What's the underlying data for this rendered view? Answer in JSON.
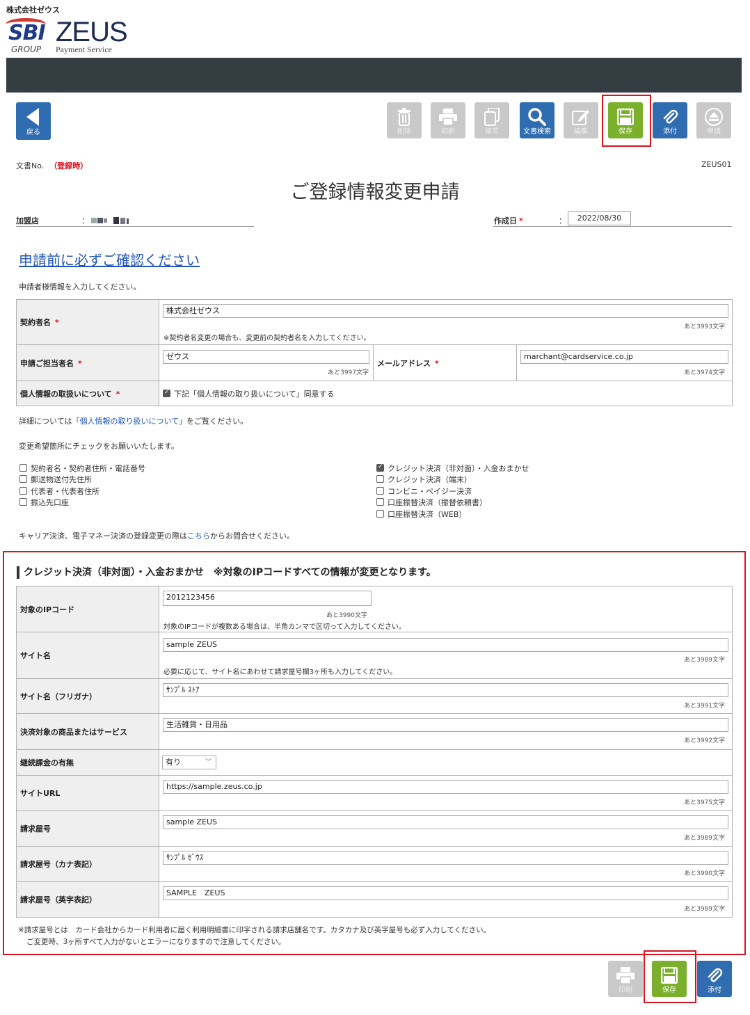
{
  "header": {
    "company": "株式会社ゼウス",
    "logo_sbi": "SBI",
    "logo_group": "GROUP",
    "logo_zeus": "ZEUS",
    "logo_payment": "Payment Service"
  },
  "toolbar": {
    "back": "戻る",
    "buttons": [
      {
        "label": "削除",
        "icon": "trash-icon",
        "state": "disabled"
      },
      {
        "label": "印刷",
        "icon": "print-icon",
        "state": "disabled"
      },
      {
        "label": "複写",
        "icon": "copy-icon",
        "state": "disabled"
      },
      {
        "label": "文書検索",
        "icon": "search-icon",
        "state": "enabled"
      },
      {
        "label": "編集",
        "icon": "edit-icon",
        "state": "disabled"
      },
      {
        "label": "保存",
        "icon": "save-icon",
        "state": "highlighted"
      },
      {
        "label": "添付",
        "icon": "paperclip-icon",
        "state": "enabled"
      },
      {
        "label": "申請",
        "icon": "eject-icon",
        "state": "disabled"
      }
    ]
  },
  "doc": {
    "no_label": "文書No.",
    "no_value": "（登録時）",
    "code": "ZEUS01",
    "title": "ご登録情報変更申請",
    "merchant_label": "加盟店",
    "colon": "：",
    "created_label": "作成日",
    "required_mark": "*",
    "created_value": "2022/08/30"
  },
  "intro": {
    "link": "申請前に必ずご確認ください",
    "instruction": "申請者様情報を入力してください。"
  },
  "applicant": {
    "contractor_label": "契約者名",
    "contractor_value": "株式会社ゼウス",
    "contractor_count": "あと3993文字",
    "contractor_hint": "※契約者名変更の場合も、変更前の契約者名を入力してください。",
    "person_label": "申請ご担当者名",
    "person_value": "ゼウス",
    "person_count": "あと3997文字",
    "email_label": "メールアドレス",
    "email_value": "marchant@cardservice.co.jp",
    "email_count": "あと3974文字",
    "privacy_label": "個人情報の取扱いについて",
    "privacy_check": "下記「個人情報の取り扱いについて」同意する"
  },
  "privacy_note": {
    "prefix": "詳細については",
    "link": "「個人情報の取り扱いについて」",
    "suffix": "をご覧ください。"
  },
  "change_prompt": "変更希望箇所にチェックをお願いいたします。",
  "change_options_left": [
    {
      "label": "契約者名・契約者住所・電話番号",
      "checked": false
    },
    {
      "label": "郵送物送付先住所",
      "checked": false
    },
    {
      "label": "代表者・代表者住所",
      "checked": false
    },
    {
      "label": "振込先口座",
      "checked": false
    }
  ],
  "change_options_right": [
    {
      "label": "クレジット決済（非対面）・入金おまかせ",
      "checked": true
    },
    {
      "label": "クレジット決済（端末）",
      "checked": false
    },
    {
      "label": "コンビニ・ペイジー決済",
      "checked": false
    },
    {
      "label": "口座振替決済（振替依頼書）",
      "checked": false
    },
    {
      "label": "口座振替決済（WEB）",
      "checked": false
    }
  ],
  "carrier_note": {
    "prefix": "キャリア決済、電子マネー決済の登録変更の際は",
    "link": "こちら",
    "suffix": "からお問合せください。"
  },
  "credit": {
    "title": "クレジット決済（非対面）・入金おまかせ　※対象のIPコードすべての情報が変更となります。",
    "rows": {
      "ipcode": {
        "label": "対象のIPコード",
        "value": "2012123456",
        "count": "あと3990文字",
        "hint": "対象のIPコードが複数ある場合は、半角カンマで区切って入力してください。"
      },
      "site_name": {
        "label": "サイト名",
        "value": "sample ZEUS",
        "count": "あと3989文字",
        "hint": "必要に応じて、サイト名にあわせて請求屋号欄3ヶ所も入力してください。"
      },
      "site_kana": {
        "label": "サイト名（フリガナ）",
        "value": "ｻﾝﾌﾟﾙ ｽﾄｱ",
        "count": "あと3991文字"
      },
      "product": {
        "label": "決済対象の商品またはサービス",
        "value": "生活雑貨・日用品",
        "count": "あと3992文字"
      },
      "recurring": {
        "label": "継続課金の有無",
        "value": "有り"
      },
      "site_url": {
        "label": "サイトURL",
        "value": "https://sample.zeus.co.jp",
        "count": "あと3975文字"
      },
      "billing": {
        "label": "請求屋号",
        "value": "sample ZEUS",
        "count": "あと3989文字"
      },
      "billing_kana": {
        "label": "請求屋号（カナ表記）",
        "value": "ｻﾝﾌﾟﾙ ｾﾞｳｽ",
        "count": "あと3990文字"
      },
      "billing_en": {
        "label": "請求屋号（英字表記）",
        "value": "SAMPLE　ZEUS",
        "count": "あと3989文字"
      }
    },
    "footnote1": "※請求屋号とは　カード会社からカード利用者に届く利用明細書に印字される請求店舗名です。カタカナ及び英字屋号も必ず入力してください。",
    "footnote2": "ご変更時、3ヶ所すべて入力がないとエラーになりますので注意してください。"
  },
  "bottom_toolbar": [
    {
      "label": "印刷",
      "icon": "print-icon",
      "state": "disabled"
    },
    {
      "label": "保存",
      "icon": "save-icon",
      "state": "highlighted"
    },
    {
      "label": "添付",
      "icon": "paperclip-icon",
      "state": "enabled"
    }
  ],
  "colors": {
    "accent_blue": "#2f6cb0",
    "save_green": "#7ab02c",
    "highlight_red": "#d9141e",
    "topbar": "#333d42"
  }
}
